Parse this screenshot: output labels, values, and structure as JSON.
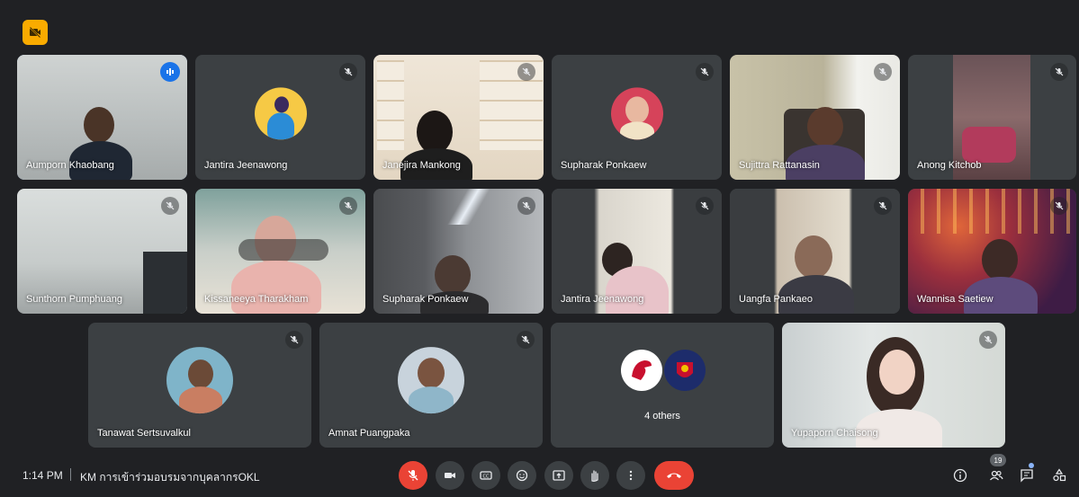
{
  "participants": [
    {
      "name": "Aumporn Khaobang"
    },
    {
      "name": "Jantira Jeenawong"
    },
    {
      "name": "Janejira Mankong"
    },
    {
      "name": "Supharak Ponkaew"
    },
    {
      "name": "Sujittra Rattanasin"
    },
    {
      "name": "Anong Kitchob"
    },
    {
      "name": "Sunthorn Pumphuang"
    },
    {
      "name": "Kissaneeya Tharakham"
    },
    {
      "name": "Supharak Ponkaew"
    },
    {
      "name": "Jantira Jeenawong"
    },
    {
      "name": "Uangfa Pankaeo"
    },
    {
      "name": "Wannisa Saetiew"
    },
    {
      "name": "Tanawat Sertsuvalkul"
    },
    {
      "name": "Amnat Puangpaka"
    },
    {
      "name": "4 others"
    },
    {
      "name": "Yupaporn Chaisong"
    }
  ],
  "bottom_bar": {
    "time": "1:14 PM",
    "meeting_title": "KM การเข้าร่วมอบรมจากบุคลากรOKL",
    "people_count": "19"
  },
  "colors": {
    "background": "#202124",
    "tile": "#3c4043",
    "accent_blue": "#8ab4f8",
    "danger_red": "#ea4335",
    "badge_yellow": "#f9ab00"
  },
  "icons": {
    "top_badge": "camera-off-icon",
    "mute": "mic-off-icon",
    "speaking": "audio-level-icon",
    "controls": [
      "mic-off-icon",
      "camera-icon",
      "captions-icon",
      "emoji-icon",
      "present-icon",
      "raise-hand-icon",
      "more-options-icon",
      "end-call-icon"
    ],
    "right_controls": [
      "info-icon",
      "people-icon",
      "chat-icon",
      "activities-icon"
    ]
  }
}
